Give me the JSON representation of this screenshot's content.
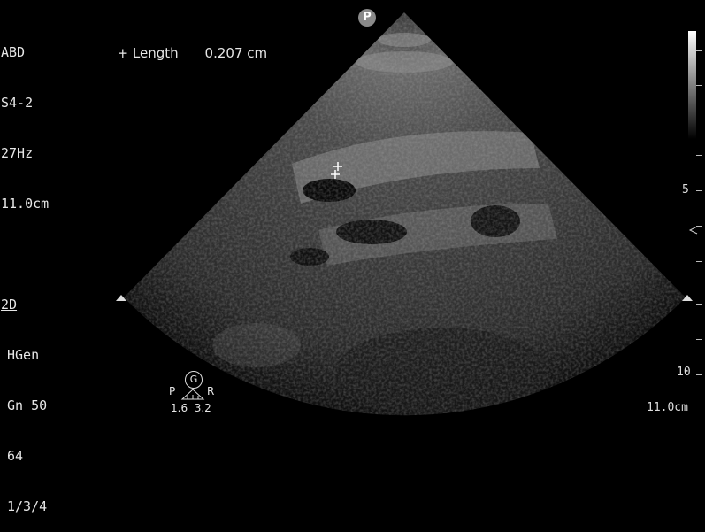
{
  "settings": {
    "preset": "ABD",
    "probe": "S4-2",
    "frame_rate": "27Hz",
    "depth": "11.0cm",
    "mode": "2D",
    "harmonic": "HGen",
    "gain": "Gn 50",
    "dynamic_range": "64",
    "persistence": "1/3/4"
  },
  "measurement": {
    "tool_label": "+ Length",
    "value": "0.207 cm"
  },
  "probe_marker": "P",
  "depth_scale": {
    "label_5": "5",
    "label_10": "10",
    "label_depth": "11.0cm"
  },
  "orientation": {
    "g_label": "G",
    "left_label": "P",
    "right_label": "R",
    "values": "1.6  3.2"
  },
  "colors": {
    "background": "#000000",
    "text": "#e6e6e6"
  }
}
